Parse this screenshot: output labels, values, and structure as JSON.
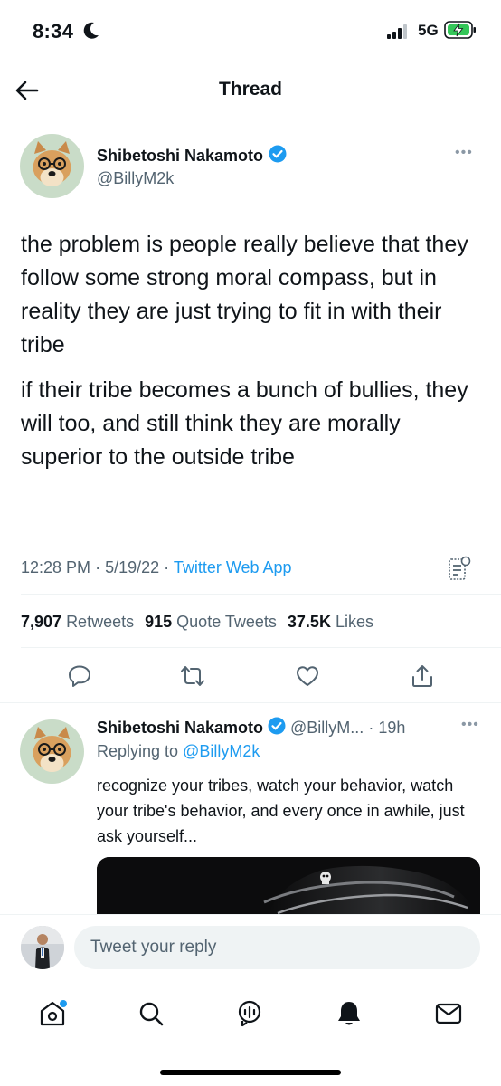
{
  "status_bar": {
    "time": "8:34",
    "network": "5G"
  },
  "header": {
    "title": "Thread"
  },
  "main_tweet": {
    "author_name": "Shibetoshi Nakamoto",
    "handle": "@BillyM2k",
    "paragraphs": [
      "the problem is people really believe that they follow some strong moral compass, but in reality they are just trying to fit in with their tribe",
      "if their tribe becomes a bunch of bullies, they will too, and still think they are morally superior to the outside tribe"
    ],
    "time": "12:28 PM",
    "date": "5/19/22",
    "separator": "·",
    "source": "Twitter Web App",
    "stats": {
      "retweets_count": "7,907",
      "retweets_label": "Retweets",
      "quotes_count": "915",
      "quotes_label": "Quote Tweets",
      "likes_count": "37.5K",
      "likes_label": "Likes"
    }
  },
  "reply_tweet": {
    "author_name": "Shibetoshi Nakamoto",
    "handle": "@BillyM...",
    "separator": "·",
    "time_ago": "19h",
    "replying_prefix": "Replying to",
    "replying_to": "@BillyM2k",
    "text": "recognize your tribes, watch your behavior, watch your tribe's behavior, and every once in awhile, just ask yourself..."
  },
  "composer": {
    "placeholder": "Tweet your reply"
  },
  "colors": {
    "accent": "#1d9bf0",
    "text": "#0f1419",
    "muted": "#536471",
    "divider": "#eff3f4",
    "verified": "#1d9bf0",
    "battery": "#34c759"
  },
  "icons": [
    "moon-icon",
    "signal-icon",
    "battery-charging-icon",
    "back-arrow-icon",
    "verified-badge-icon",
    "more-icon",
    "analytics-icon",
    "reply-icon",
    "retweet-icon",
    "like-icon",
    "share-icon",
    "home-icon",
    "search-icon",
    "spaces-icon",
    "notifications-icon",
    "messages-icon"
  ]
}
